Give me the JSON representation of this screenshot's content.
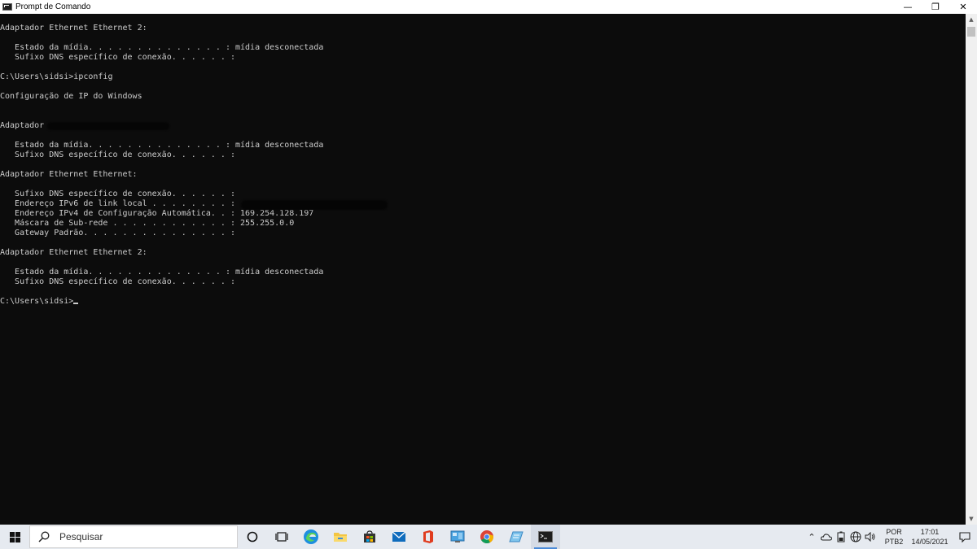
{
  "window": {
    "title": "Prompt de Comando",
    "minimize_glyph": "—",
    "maximize_glyph": "❐",
    "close_glyph": "✕"
  },
  "console": {
    "lines": [
      "Adaptador Ethernet Ethernet 2:",
      "",
      "   Estado da mídia. . . . . . . . . . . . . . : mídia desconectada",
      "   Sufixo DNS específico de conexão. . . . . . :",
      "",
      "C:\\Users\\sidsi>ipconfig",
      "",
      "Configuração de IP do Windows",
      "",
      "",
      "Adaptador",
      "",
      "   Estado da mídia. . . . . . . . . . . . . . : mídia desconectada",
      "   Sufixo DNS específico de conexão. . . . . . :",
      "",
      "Adaptador Ethernet Ethernet:",
      "",
      "   Sufixo DNS específico de conexão. . . . . . :",
      "   Endereço IPv6 de link local . . . . . . . . :",
      "   Endereço IPv4 de Configuração Automática. . : 169.254.128.197",
      "   Máscara de Sub-rede . . . . . . . . . . . . : 255.255.0.0",
      "   Gateway Padrão. . . . . . . . . . . . . . . :",
      "",
      "Adaptador Ethernet Ethernet 2:",
      "",
      "   Estado da mídia. . . . . . . . . . . . . . : mídia desconectada",
      "   Sufixo DNS específico de conexão. . . . . . :",
      ""
    ],
    "prompt": "C:\\Users\\sidsi>"
  },
  "taskbar": {
    "search_placeholder": "Pesquisar",
    "apps": [
      "task-view",
      "edge",
      "file-explorer",
      "store",
      "mail",
      "office",
      "control-panel",
      "chrome",
      "notepad",
      "command-prompt"
    ],
    "active_app": "command-prompt",
    "tray": {
      "language_line1": "POR",
      "language_line2": "PTB2",
      "time": "17:01",
      "date": "14/05/2021"
    }
  },
  "colors": {
    "console_bg": "#0c0c0c",
    "console_text": "#cccccc",
    "taskbar_bg": "#e6eaf0"
  }
}
